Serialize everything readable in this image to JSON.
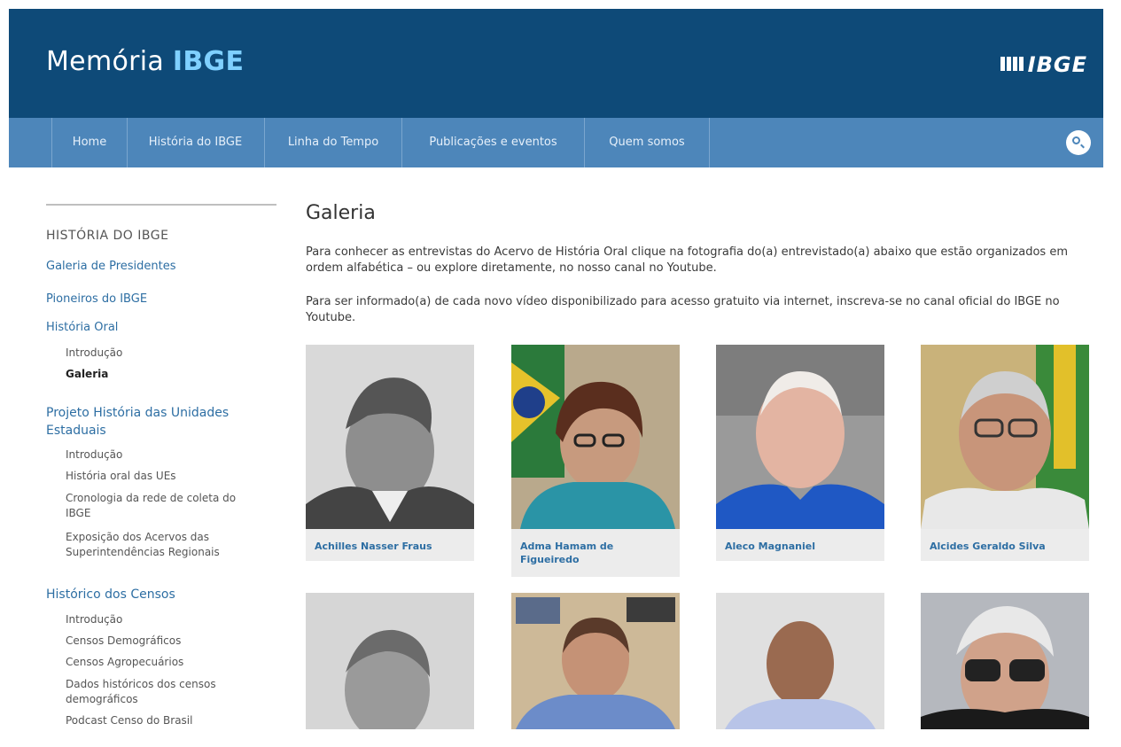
{
  "header": {
    "title_light": "Memória ",
    "title_bold": "IBGE",
    "logo_text": "IBGE"
  },
  "nav": {
    "items": [
      "Home",
      "História do IBGE",
      "Linha do Tempo",
      "Publicações e eventos",
      "Quem somos"
    ]
  },
  "sidebar": {
    "heading": "HISTÓRIA DO IBGE",
    "links": {
      "presidents": "Galeria de Presidentes",
      "pioneers": "Pioneiros do IBGE",
      "oral_history": "História Oral",
      "oral_intro": "Introdução",
      "oral_gallery": "Galeria",
      "project": "Projeto História das Unidades Estaduais",
      "project_intro": "Introdução",
      "project_oral": "História oral das UEs",
      "project_chronology": "Cronologia da rede de coleta do IBGE",
      "project_exposition": "Exposição dos Acervos das Superintendências Regionais",
      "census": "Histórico dos Censos",
      "census_intro": "Introdução",
      "census_demo": "Censos Demográficos",
      "census_agro": "Censos Agropecuários",
      "census_hist": "Dados históricos dos censos demográficos",
      "census_podcast": "Podcast Censo do Brasil"
    }
  },
  "main": {
    "title": "Galeria",
    "paragraph1": "Para conhecer as entrevistas do Acervo de História Oral clique na fotografia do(a) entrevistado(a) abaixo que estão organizados em ordem alfabética – ou explore diretamente, no nosso canal no Youtube.",
    "paragraph2": "Para ser informado(a) de cada novo vídeo disponibilizado para acesso gratuito via internet, inscreva-se no canal oficial do IBGE no Youtube."
  },
  "gallery": [
    {
      "name": "Achilles Nasser Fraus"
    },
    {
      "name": "Adma Hamam de Figueiredo"
    },
    {
      "name": "Aleco Magnaniel"
    },
    {
      "name": "Alcides Geraldo Silva"
    },
    {
      "name": ""
    },
    {
      "name": ""
    },
    {
      "name": ""
    },
    {
      "name": ""
    }
  ]
}
